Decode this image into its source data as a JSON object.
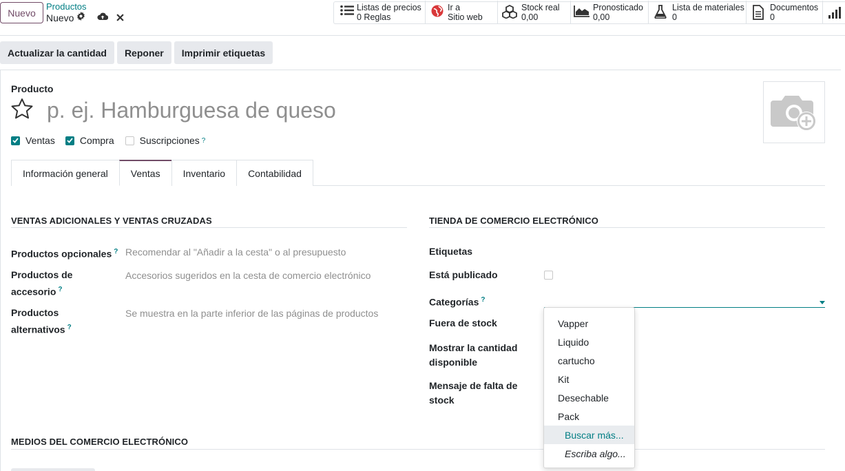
{
  "control_panel": {
    "new_button": "Nuevo",
    "breadcrumb_parent": "Productos",
    "breadcrumb_current": "Nuevo",
    "smart_buttons": [
      {
        "icon": "list-icon",
        "line1": "Listas de precios",
        "line2": "0  Reglas"
      },
      {
        "icon": "globe-icon",
        "line1": "Ir a",
        "line2": "Sitio web"
      },
      {
        "icon": "cubes-icon",
        "line1": "Stock real",
        "line2": "0,00"
      },
      {
        "icon": "area-chart-icon",
        "line1": "Pronosticado",
        "line2": "0,00"
      },
      {
        "icon": "flask-icon",
        "line1": "Lista de materiales",
        "line2": "0"
      },
      {
        "icon": "document-icon",
        "line1": "Documentos",
        "line2": "0"
      }
    ]
  },
  "action_bar": {
    "update_qty": "Actualizar la cantidad",
    "replenish": "Reponer",
    "print_labels": "Imprimir etiquetas"
  },
  "product": {
    "label": "Producto",
    "name_placeholder": "p. ej. Hamburguesa de queso",
    "checkboxes": [
      {
        "label": "Ventas",
        "checked": true
      },
      {
        "label": "Compra",
        "checked": true
      },
      {
        "label": "Suscripciones",
        "checked": false
      }
    ],
    "help_mark": "?"
  },
  "tabs": [
    {
      "label": "Información general",
      "active": false
    },
    {
      "label": "Ventas",
      "active": true
    },
    {
      "label": "Inventario",
      "active": false
    },
    {
      "label": "Contabilidad",
      "active": false
    }
  ],
  "upsell": {
    "title": "VENTAS ADICIONALES Y VENTAS CRUZADAS",
    "optional_label": "Productos opcionales",
    "optional_placeholder": "Recomendar al \"Añadir a la cesta\" o al presupuesto",
    "accessory_label_1": "Productos de",
    "accessory_label_2": "accesorio",
    "accessory_placeholder": "Accesorios sugeridos en la cesta de comercio electrónico",
    "alternative_label_1": "Productos",
    "alternative_label_2": "alternativos",
    "alternative_placeholder": "Se muestra en la parte inferior de las páginas de productos"
  },
  "ecommerce": {
    "title": "TIENDA DE COMERCIO ELECTRÓNICO",
    "tags_label": "Etiquetas",
    "published_label": "Está publicado",
    "published": false,
    "categories_label": "Categorías",
    "out_of_stock_label": "Fuera de stock",
    "show_qty_label_1": "Mostrar la cantidad",
    "show_qty_label_2": "disponible",
    "oos_message_label_1": "Mensaje de falta de",
    "oos_message_label_2": "stock"
  },
  "category_dropdown": {
    "options": [
      "Vapper",
      "Liquido",
      "cartucho",
      "Kit",
      "Desechable",
      "Pack"
    ],
    "search_more": "Buscar más...",
    "create_hint": "Escriba algo..."
  },
  "media": {
    "title": "MEDIOS DEL COMERCIO ELECTRÓNICO"
  },
  "colors": {
    "primary": "#714b67",
    "accent": "#017e84",
    "muted": "#8f8f8f"
  }
}
